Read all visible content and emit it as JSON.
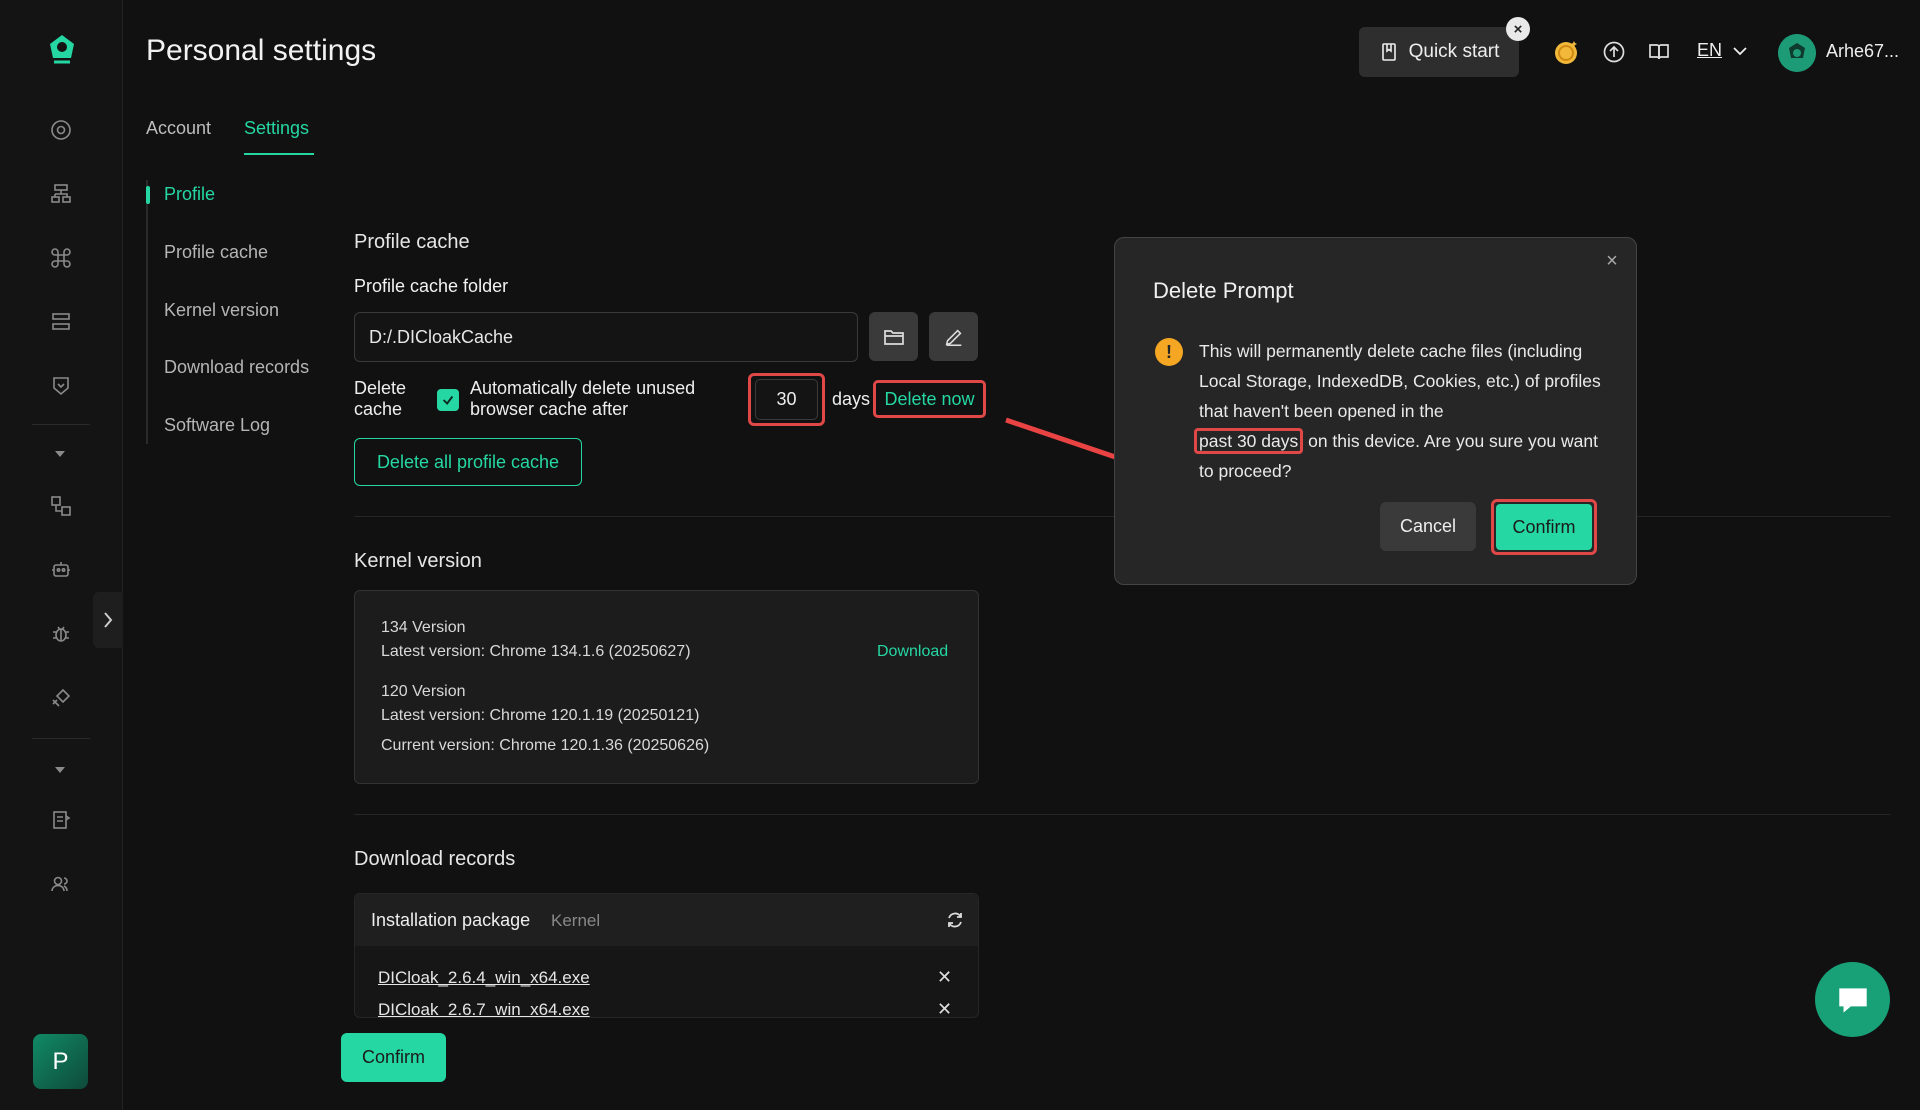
{
  "header": {
    "title": "Personal settings",
    "quick_start": "Quick start",
    "quick_close": "×",
    "language": "EN",
    "username": "Arhe67..."
  },
  "tabs": [
    {
      "label": "Account",
      "active": false
    },
    {
      "label": "Settings",
      "active": true
    }
  ],
  "subnav": [
    {
      "label": "Profile",
      "active": true
    },
    {
      "label": "Profile cache",
      "active": false
    },
    {
      "label": "Kernel version",
      "active": false
    },
    {
      "label": "Download records",
      "active": false
    },
    {
      "label": "Software Log",
      "active": false
    }
  ],
  "rail": {
    "avatar_letter": "P",
    "collapse": "›"
  },
  "profile_cache": {
    "title": "Profile cache",
    "folder_label": "Profile cache folder",
    "folder_value": "D:/.DICloakCache",
    "delete_label_line1": "Delete",
    "delete_label_line2": "cache",
    "auto_delete_text": "Automatically delete unused browser cache after",
    "auto_delete_checked": true,
    "days_value": "30",
    "days_unit": "days",
    "delete_now": "Delete now",
    "delete_all": "Delete all profile cache"
  },
  "kernel": {
    "title": "Kernel version",
    "v134_title": "134 Version",
    "v134_latest": "Latest version: Chrome 134.1.6 (20250627)",
    "v134_action": "Download",
    "v120_title": "120 Version",
    "v120_latest": "Latest version: Chrome 120.1.19 (20250121)",
    "v120_current": "Current version: Chrome 120.1.36 (20250626)"
  },
  "downloads": {
    "title": "Download records",
    "tab_installation": "Installation package",
    "tab_kernel": "Kernel",
    "files": [
      {
        "name": "DICloak_2.6.4_win_x64.exe",
        "remove": "✕"
      },
      {
        "name": "DICloak_2.6.7_win_x64.exe",
        "remove": "✕"
      }
    ]
  },
  "bottom_confirm": "Confirm",
  "modal": {
    "title": "Delete Prompt",
    "close": "×",
    "warn_icon": "!",
    "text_before": "This will permanently delete cache files (including Local Storage, IndexedDB, Cookies, etc.) of profiles that haven't been opened in the",
    "text_highlight": "past 30 days",
    "text_after": "on this device. Are you sure you want to proceed?",
    "cancel": "Cancel",
    "confirm": "Confirm"
  },
  "colors": {
    "accent": "#25d7a2",
    "background": "#111111",
    "annotation_red": "#e04848",
    "warning": "#f5a623"
  }
}
